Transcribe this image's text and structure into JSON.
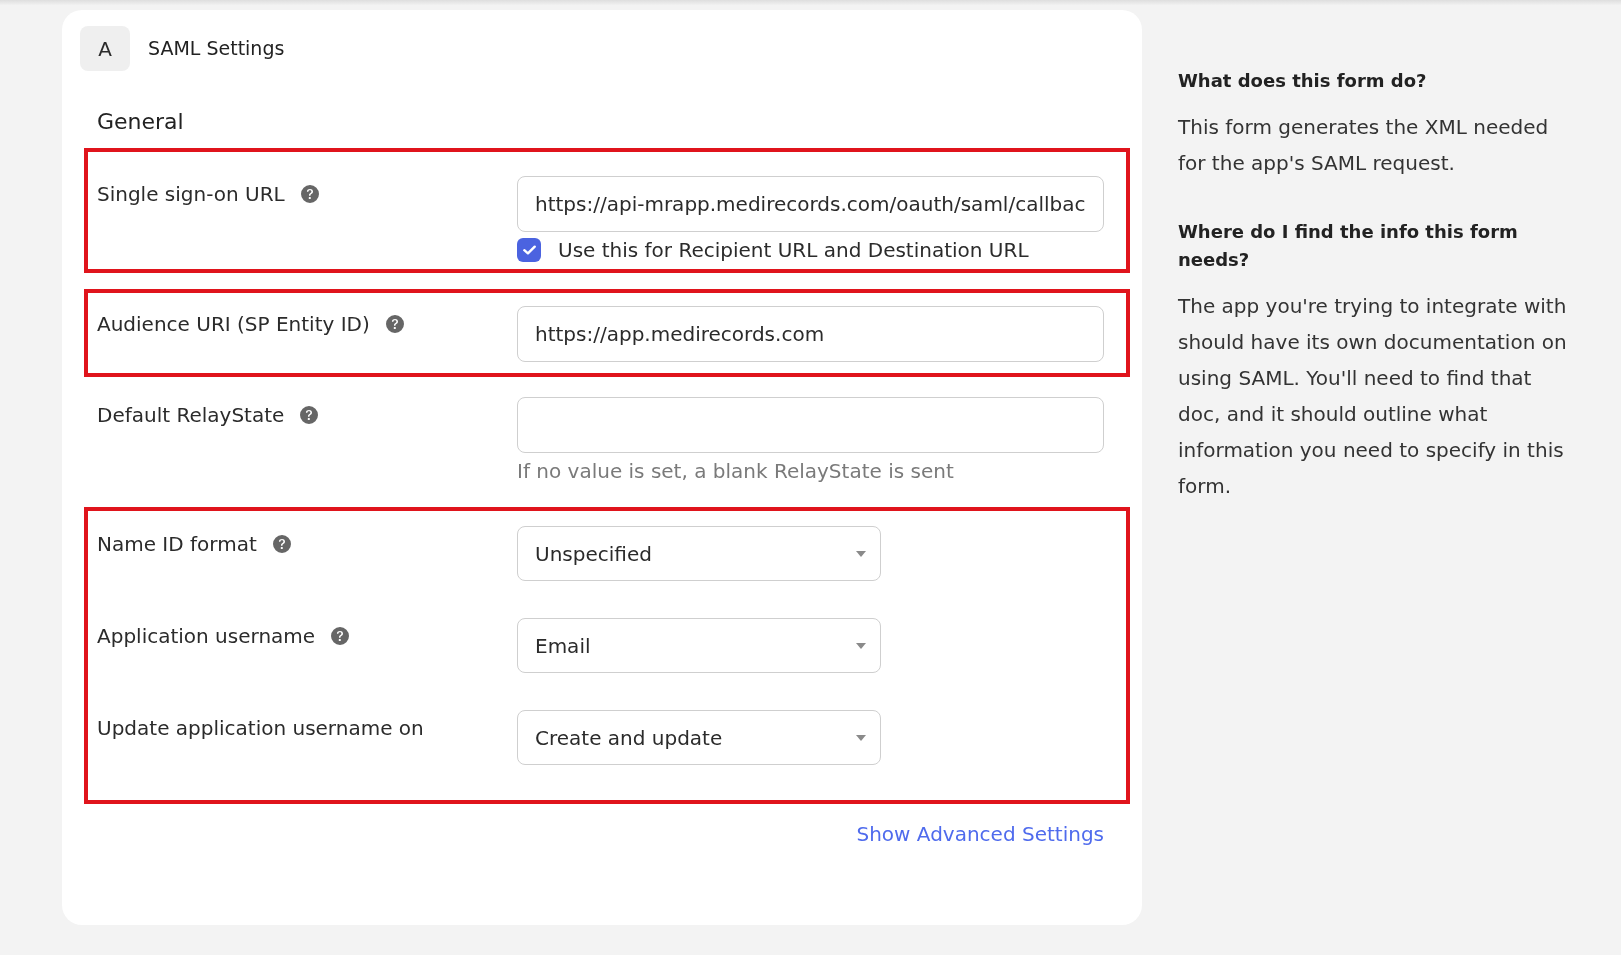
{
  "header": {
    "badge": "A",
    "title": "SAML Settings"
  },
  "section_title": "General",
  "groups": [
    {
      "highlighted": true,
      "fields": [
        {
          "kind": "text",
          "label": "Single sign-on URL",
          "help": true,
          "value": "https://api-mrapp.medirecords.com/oauth/saml/callbac",
          "checkbox": {
            "label": "Use this for Recipient URL and Destination URL",
            "checked": true
          }
        }
      ]
    },
    {
      "highlighted": true,
      "fields": [
        {
          "kind": "text",
          "label": "Audience URI (SP Entity ID)",
          "help": true,
          "value": "https://app.medirecords.com"
        }
      ]
    },
    {
      "highlighted": false,
      "fields": [
        {
          "kind": "text",
          "label": "Default RelayState",
          "help": true,
          "hint": "If no value is set, a blank RelayState is sent"
        }
      ]
    },
    {
      "highlighted": true,
      "fields": [
        {
          "kind": "select",
          "label": "Name ID format",
          "help": true,
          "value": "Unspecified"
        },
        {
          "kind": "select",
          "label": "Application username",
          "help": true,
          "value": "Email"
        },
        {
          "kind": "select",
          "label": "Update application username on",
          "help": false,
          "value": "Create and update"
        }
      ]
    }
  ],
  "advanced_link": "Show Advanced Settings",
  "sidebar": [
    {
      "heading": "What does this form do?",
      "text": "This form generates the XML needed for the app's SAML request."
    },
    {
      "heading": "Where do I find the info this form needs?",
      "text": "The app you're trying to integrate with should have its own documentation on using SAML. You'll need to find that doc, and it should outline what information you need to specify in this form."
    }
  ]
}
